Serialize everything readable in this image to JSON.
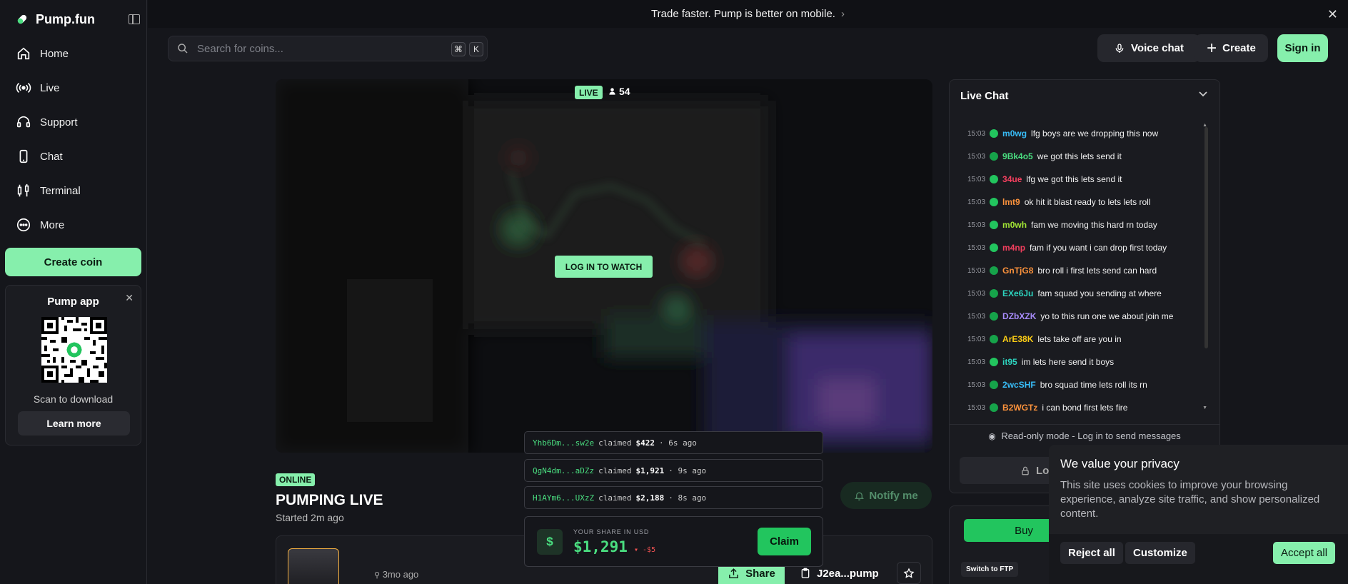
{
  "brand": {
    "name": "Pump.fun"
  },
  "sidebar": {
    "items": [
      {
        "label": "Home",
        "icon": "home-icon"
      },
      {
        "label": "Live",
        "icon": "live-icon"
      },
      {
        "label": "Support",
        "icon": "headset-icon"
      },
      {
        "label": "Chat",
        "icon": "phone-icon"
      },
      {
        "label": "Terminal",
        "icon": "candlestick-icon"
      },
      {
        "label": "More",
        "icon": "more-icon"
      }
    ],
    "create_coin": "Create coin",
    "app_card": {
      "title": "Pump app",
      "scan": "Scan to download",
      "learn": "Learn more"
    }
  },
  "banner": {
    "text": "Trade faster. Pump is better on mobile."
  },
  "header": {
    "search_placeholder": "Search for coins...",
    "shortcut_mod": "⌘",
    "shortcut_key": "K",
    "voice_chat": "Voice chat",
    "create": "Create",
    "sign_in": "Sign in"
  },
  "stream": {
    "live_badge": "LIVE",
    "viewers": "54",
    "login_to_watch": "LOG IN TO WATCH",
    "status": "ONLINE",
    "title": "PUMPING LIVE",
    "started": "Started 2m ago",
    "notify": "Notify me",
    "age": "3mo ago",
    "share": "Share",
    "contract": "J2ea...pump"
  },
  "claims": [
    {
      "addr": "Yhb6Dm...sw2e",
      "verb": "claimed",
      "amount": "$422",
      "ago": "· 6s ago"
    },
    {
      "addr": "QgN4dm...aDZz",
      "verb": "claimed",
      "amount": "$1,921",
      "ago": "· 9s ago"
    },
    {
      "addr": "H1AYm6...UXzZ",
      "verb": "claimed",
      "amount": "$2,188",
      "ago": "· 8s ago"
    }
  ],
  "share_card": {
    "label": "YOUR SHARE IN USD",
    "value": "$1,291",
    "delta": "▾ -$5",
    "claim": "Claim",
    "icon_glyph": "$"
  },
  "chat": {
    "title": "Live Chat",
    "messages": [
      {
        "time": "15:03",
        "user": "m0wg",
        "text": "lfg boys are we dropping this now",
        "color": "#38bdf8",
        "avatar": "#22c55e"
      },
      {
        "time": "15:03",
        "user": "9Bk4o5",
        "text": "we got this lets send it",
        "color": "#4ade80",
        "avatar": "#16a34a"
      },
      {
        "time": "15:03",
        "user": "34ue",
        "text": "lfg we got this lets send it",
        "color": "#f43f5e",
        "avatar": "#22c55e"
      },
      {
        "time": "15:03",
        "user": "lmt9",
        "text": "ok hit it blast ready to lets lets roll",
        "color": "#fb923c",
        "avatar": "#22c55e"
      },
      {
        "time": "15:03",
        "user": "m0wh",
        "text": "fam we moving this hard rn today",
        "color": "#a3e635",
        "avatar": "#22c55e"
      },
      {
        "time": "15:03",
        "user": "m4np",
        "text": "fam if you want i can drop first today",
        "color": "#f43f5e",
        "avatar": "#22c55e"
      },
      {
        "time": "15:03",
        "user": "GnTjG8",
        "text": "bro roll i first lets send can hard",
        "color": "#fb923c",
        "avatar": "#16a34a"
      },
      {
        "time": "15:03",
        "user": "EXe6Ju",
        "text": "fam squad you sending at where",
        "color": "#2dd4bf",
        "avatar": "#16a34a"
      },
      {
        "time": "15:03",
        "user": "DZbXZK",
        "text": "yo to this run one we about join me",
        "color": "#a78bfa",
        "avatar": "#16a34a"
      },
      {
        "time": "15:03",
        "user": "ArE38K",
        "text": "lets take off are you in",
        "color": "#facc15",
        "avatar": "#16a34a"
      },
      {
        "time": "15:03",
        "user": "it95",
        "text": "im lets here send it boys",
        "color": "#2dd4bf",
        "avatar": "#22c55e"
      },
      {
        "time": "15:03",
        "user": "2wcSHF",
        "text": "bro squad time lets roll its rn",
        "color": "#38bdf8",
        "avatar": "#16a34a"
      },
      {
        "time": "15:03",
        "user": "B2WGTz",
        "text": "i can bond first lets fire",
        "color": "#fb923c",
        "avatar": "#16a34a"
      }
    ],
    "readonly": "Read-only mode - Log in to send messages",
    "login": "Lo"
  },
  "trade": {
    "buy": "Buy",
    "switch_ftp": "Switch to FTP"
  },
  "privacy": {
    "title": "We value your privacy",
    "text": "This site uses cookies to improve your browsing experience, analyze site traffic, and show personalized content.",
    "reject": "Reject all",
    "customize": "Customize",
    "accept": "Accept all"
  },
  "colors": {
    "accent": "#86efac",
    "accent_strong": "#22c55e",
    "background": "#15161b"
  }
}
